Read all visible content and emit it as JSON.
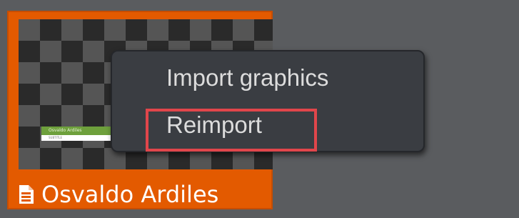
{
  "thumbnail": {
    "file_name": "Osvaldo Ardiles",
    "preview_name_text": "Osvaldo Ardiles",
    "preview_subtitle_text": "SUBTITLE",
    "accent_color": "#e35a00"
  },
  "context_menu": {
    "items": [
      {
        "label": "Import graphics"
      },
      {
        "label": "Reimport",
        "highlighted": true
      }
    ],
    "highlight_color": "#e1464b"
  },
  "icons": {
    "file_icon": "document-icon"
  }
}
